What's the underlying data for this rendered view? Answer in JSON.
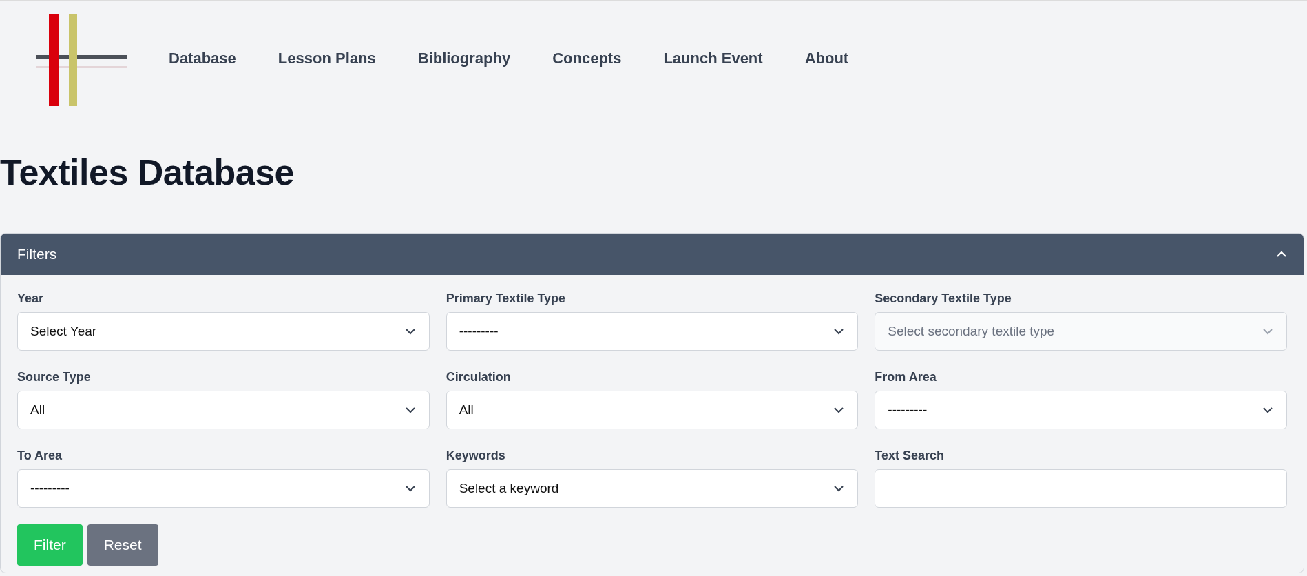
{
  "nav": {
    "items": [
      "Database",
      "Lesson Plans",
      "Bibliography",
      "Concepts",
      "Launch Event",
      "About"
    ]
  },
  "page": {
    "title": "Textiles Database"
  },
  "filters": {
    "title": "Filters",
    "expanded": true,
    "fields": [
      {
        "label": "Year",
        "kind": "select",
        "value": "Select Year",
        "disabled": false
      },
      {
        "label": "Primary Textile Type",
        "kind": "select",
        "value": "---------",
        "disabled": false
      },
      {
        "label": "Secondary Textile Type",
        "kind": "select",
        "placeholder": "Select secondary textile type",
        "disabled": true
      },
      {
        "label": "Source Type",
        "kind": "select",
        "value": "All",
        "disabled": false
      },
      {
        "label": "Circulation",
        "kind": "select",
        "value": "All",
        "disabled": false
      },
      {
        "label": "From Area",
        "kind": "select",
        "value": "---------",
        "disabled": false
      },
      {
        "label": "To Area",
        "kind": "select",
        "value": "---------",
        "disabled": false
      },
      {
        "label": "Keywords",
        "kind": "select",
        "value": "Select a keyword",
        "disabled": false
      },
      {
        "label": "Text Search",
        "kind": "text",
        "disabled": false
      }
    ],
    "buttons": [
      {
        "label": "Filter",
        "kind": "primary"
      },
      {
        "label": "Reset",
        "kind": "secondary"
      }
    ]
  }
}
